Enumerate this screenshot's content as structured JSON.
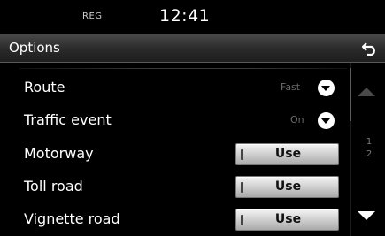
{
  "status": {
    "reg": "REG",
    "time": "12:41"
  },
  "header": {
    "title": "Options",
    "back_icon": "back-arrow-icon"
  },
  "rows": [
    {
      "label": "Route",
      "type": "dropdown",
      "value": "Fast"
    },
    {
      "label": "Traffic event",
      "type": "dropdown",
      "value": "On"
    },
    {
      "label": "Motorway",
      "type": "button",
      "button_label": "Use"
    },
    {
      "label": "Toll road",
      "type": "button",
      "button_label": "Use"
    },
    {
      "label": "Vignette road",
      "type": "button",
      "button_label": "Use"
    }
  ],
  "scroll": {
    "page_current": "1",
    "page_total": "2"
  },
  "colors": {
    "background": "#000000",
    "header": "#2a2a2a",
    "button": "#d0d0d0"
  }
}
